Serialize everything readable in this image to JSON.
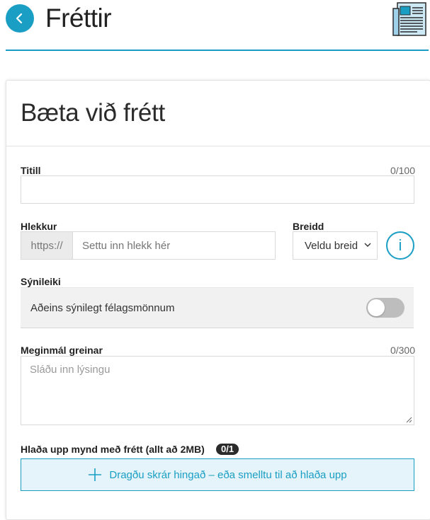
{
  "header": {
    "title": "Fréttir",
    "back_icon": "chevron-left-icon",
    "news_icon": "newspaper-icon",
    "accent": "#1a9ec4"
  },
  "form": {
    "title": "Bæta við frétt",
    "title_field": {
      "label": "Titill",
      "counter": "0/100",
      "value": ""
    },
    "link_field": {
      "label": "Hlekkur",
      "prefix": "https://",
      "placeholder": "Settu inn hlekk hér"
    },
    "width_field": {
      "label": "Breidd",
      "selected": "Veldu breid",
      "info_label": "i"
    },
    "visibility": {
      "label": "Sýnileiki",
      "toggle_label": "Aðeins sýnilegt félagsmönnum",
      "enabled": false
    },
    "body_field": {
      "label": "Meginmál greinar",
      "counter": "0/300",
      "placeholder": "Sláðu inn lýsingu"
    },
    "upload": {
      "label": "Hlaða upp mynd með frétt (allt að 2MB)",
      "count": "0/1",
      "dropzone_text": "Dragðu skrár hingað – eða smelltu til að hlaða upp"
    }
  }
}
